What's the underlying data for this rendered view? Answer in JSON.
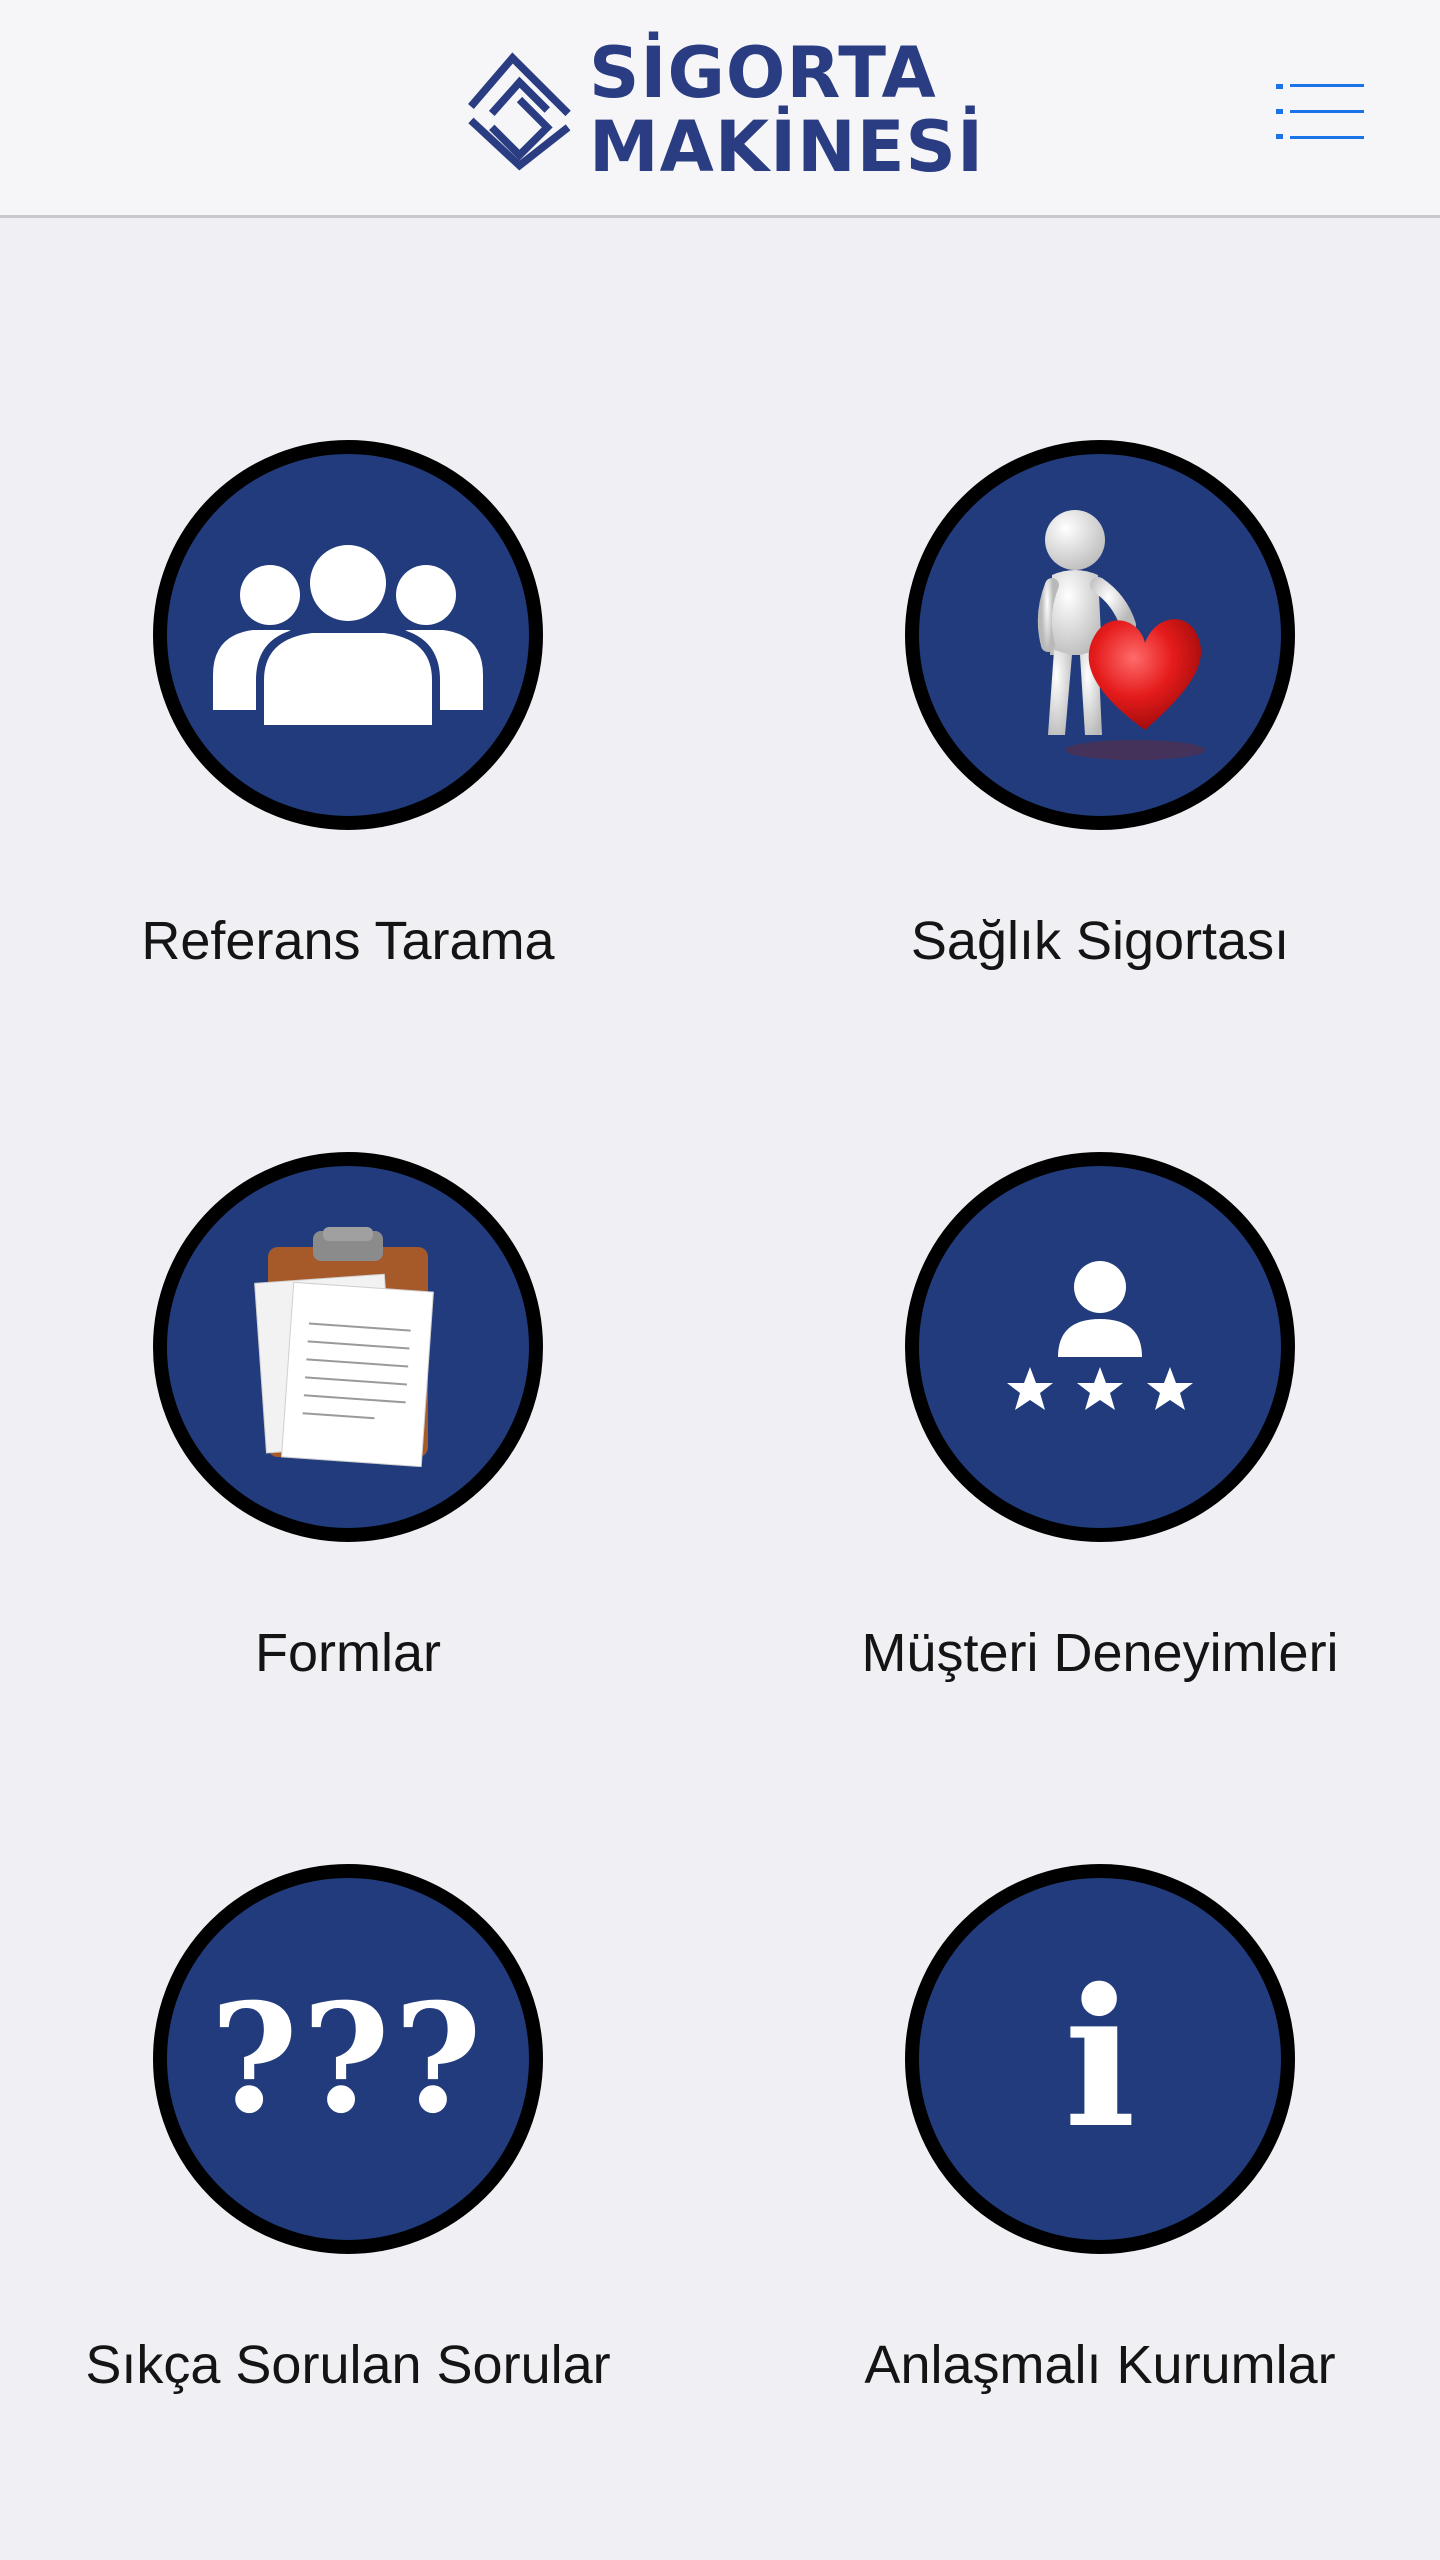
{
  "header": {
    "logo_line1": "SİGORTA",
    "logo_line2": "MAKİNESİ",
    "menu_icon": "list-menu-icon",
    "brand_color": "#2b3d82",
    "menu_color": "#1a73e8"
  },
  "tiles": [
    {
      "label": "Referans Tarama",
      "icon": "people-group-icon"
    },
    {
      "label": "Sağlık Sigortası",
      "icon": "person-with-heart-icon"
    },
    {
      "label": "Formlar",
      "icon": "clipboard-documents-icon"
    },
    {
      "label": "Müşteri Deneyimleri",
      "icon": "user-rating-stars-icon"
    },
    {
      "label": "Sıkça Sorulan Sorular",
      "icon": "question-marks-icon",
      "glyph": "???"
    },
    {
      "label": "Anlaşmalı Kurumlar",
      "icon": "info-icon",
      "glyph": "i"
    }
  ],
  "colors": {
    "circle_fill": "#213b7c",
    "circle_border": "#000000",
    "background": "#efeff4"
  }
}
